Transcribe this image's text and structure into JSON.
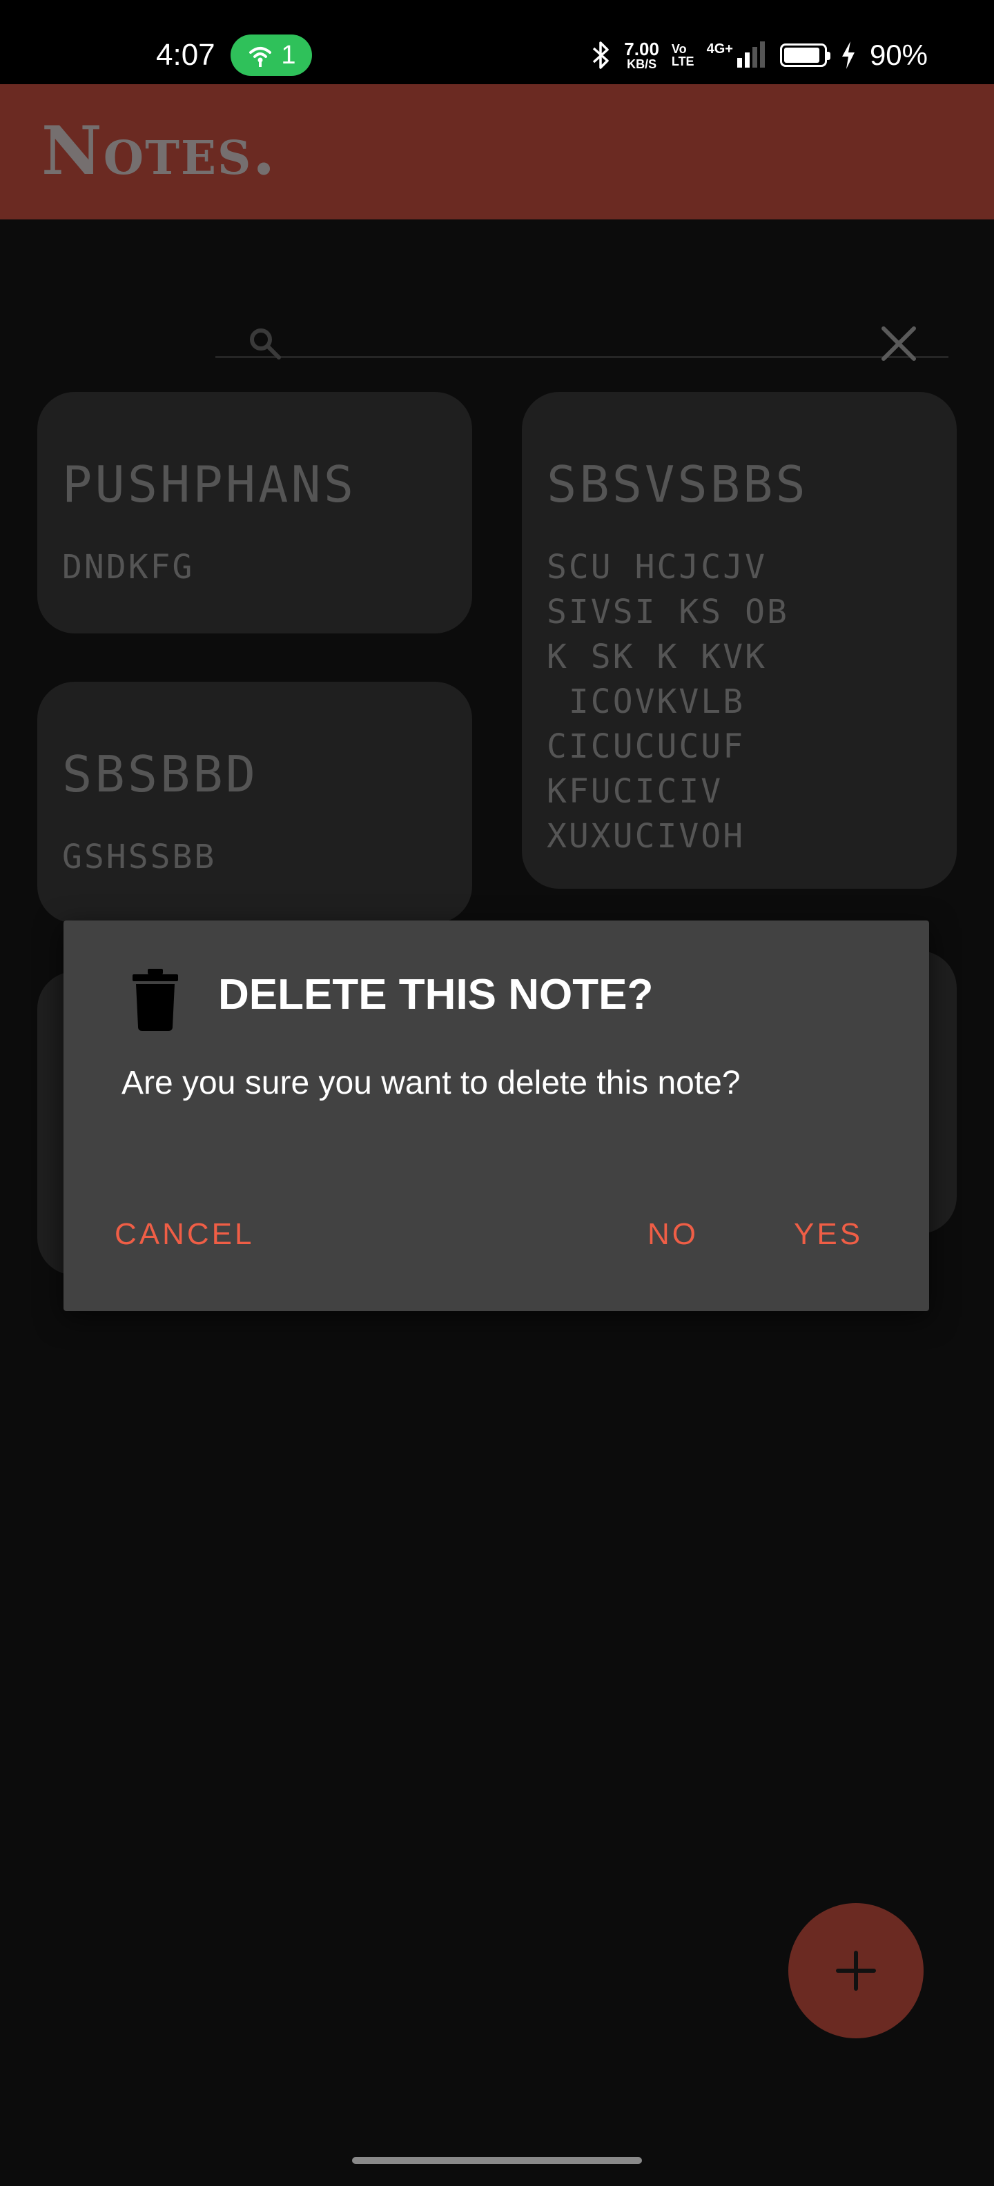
{
  "status_bar": {
    "time": "4:07",
    "hotspot_count": "1",
    "net_speed_value": "7.00",
    "net_speed_unit": "KB/S",
    "volte_top": "Vo",
    "volte_bottom": "LTE",
    "network": "4G+",
    "battery_percent": "90%",
    "icons": [
      "hotspot-icon",
      "bluetooth-icon",
      "signal-icon",
      "battery-icon",
      "charging-icon"
    ]
  },
  "app_bar": {
    "title": "Notes."
  },
  "search": {
    "value": "",
    "placeholder": ""
  },
  "notes": [
    {
      "title": "PUSHPHANS",
      "body": "DNDKFG"
    },
    {
      "title": "SBSVSBBS",
      "body": "SCU HCJCJV\nSIVSI KS OB\nK SK K KVK\n ICOVKVLB\nCICUCUCUF\nKFUCICIV\nXUXUCIVOH"
    },
    {
      "title": "SBSBBD",
      "body": "GSHSSBB"
    },
    {
      "title": "",
      "body": ""
    },
    {
      "title": "",
      "body": ""
    }
  ],
  "dialog": {
    "title": "DELETE THIS NOTE?",
    "message": "Are you sure you want to delete this note?",
    "cancel_label": "CANCEL",
    "no_label": "NO",
    "yes_label": "YES",
    "accent_color": "#ef5e46"
  },
  "colors": {
    "app_bar": "#6b2a22",
    "card": "#1f1f1f",
    "dialog": "#424242"
  }
}
